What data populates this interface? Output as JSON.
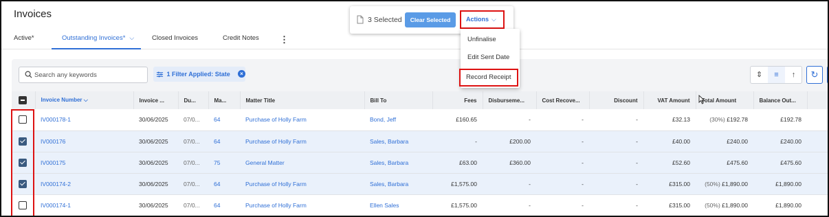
{
  "page": {
    "title": "Invoices"
  },
  "tabs": [
    {
      "label": "Active*",
      "active": false
    },
    {
      "label": "Outstanding Invoices*",
      "active": true
    },
    {
      "label": "Closed Invoices",
      "active": false
    },
    {
      "label": "Credit Notes",
      "active": false
    }
  ],
  "selection_bar": {
    "count_text": "3 Selected",
    "clear_label": "Clear Selected",
    "actions_label": "Actions"
  },
  "actions_menu": [
    "Unfinalise",
    "Edit Sent Date",
    "Record Receipt"
  ],
  "toolbar": {
    "search_placeholder": "Search any keywords",
    "filter_label": "1 Filter Applied: State"
  },
  "table": {
    "headers": {
      "invoice_number": "Invoice Number",
      "invoice_date": "Invoice ...",
      "due": "Du...",
      "matter": "Ma...",
      "matter_title": "Matter Title",
      "bill_to": "Bill To",
      "fees": "Fees",
      "disbursements": "Disburseme...",
      "cost_recovery": "Cost Recove...",
      "discount": "Discount",
      "vat": "VAT Amount",
      "total": "Total Amount",
      "balance": "Balance Out..."
    },
    "rows": [
      {
        "checked": false,
        "invoice_number": "IV000178-1",
        "invoice_date": "30/06/2025",
        "due": "07/0...",
        "matter": "64",
        "matter_title": "Purchase of Holly Farm",
        "bill_to": "Bond, Jeff",
        "fees": "£160.65",
        "disbursements": "-",
        "cost_recovery": "-",
        "discount": "-",
        "vat": "£32.13",
        "total_pct": "(30%)",
        "total": "£192.78",
        "balance": "£192.78"
      },
      {
        "checked": true,
        "invoice_number": "IV000176",
        "invoice_date": "30/06/2025",
        "due": "07/0...",
        "matter": "64",
        "matter_title": "Purchase of Holly Farm",
        "bill_to": "Sales, Barbara",
        "fees": "-",
        "disbursements": "£200.00",
        "cost_recovery": "-",
        "discount": "-",
        "vat": "£40.00",
        "total_pct": "",
        "total": "£240.00",
        "balance": "£240.00"
      },
      {
        "checked": true,
        "invoice_number": "IV000175",
        "invoice_date": "30/06/2025",
        "due": "07/0...",
        "matter": "75",
        "matter_title": "General Matter",
        "bill_to": "Sales, Barbara",
        "fees": "£63.00",
        "disbursements": "£360.00",
        "cost_recovery": "-",
        "discount": "-",
        "vat": "£52.60",
        "total_pct": "",
        "total": "£475.60",
        "balance": "£475.60"
      },
      {
        "checked": true,
        "invoice_number": "IV000174-2",
        "invoice_date": "30/06/2025",
        "due": "07/0...",
        "matter": "64",
        "matter_title": "Purchase of Holly Farm",
        "bill_to": "Sales, Barbara",
        "fees": "£1,575.00",
        "disbursements": "-",
        "cost_recovery": "-",
        "discount": "-",
        "vat": "£315.00",
        "total_pct": "(50%)",
        "total": "£1,890.00",
        "balance": "£1,890.00"
      },
      {
        "checked": false,
        "invoice_number": "IV000174-1",
        "invoice_date": "30/06/2025",
        "due": "07/0...",
        "matter": "64",
        "matter_title": "Purchase of Holly Farm",
        "bill_to": "Ellen Sales",
        "fees": "£1,575.00",
        "disbursements": "-",
        "cost_recovery": "-",
        "discount": "-",
        "vat": "£315.00",
        "total_pct": "(50%)",
        "total": "£1,890.00",
        "balance": "£1,890.00"
      }
    ]
  },
  "colors": {
    "accent": "#2f6fd6",
    "highlight": "#dd1111",
    "selected_row": "#eaf1fb"
  }
}
